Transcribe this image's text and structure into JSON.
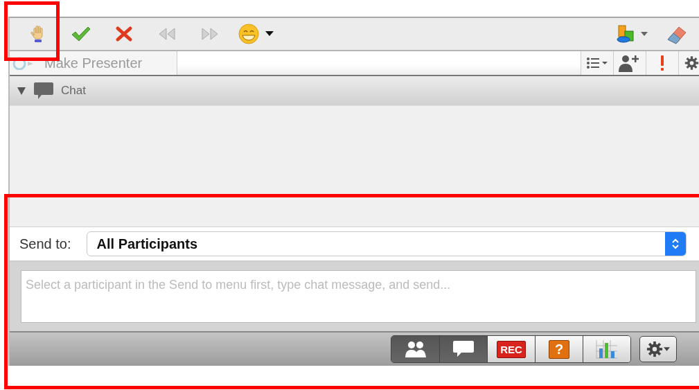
{
  "presenter_button": {
    "label": "Make Presenter",
    "disabled": true
  },
  "chat_panel": {
    "title": "Chat",
    "expanded": true
  },
  "send_to": {
    "label": "Send to:",
    "value": "All Participants"
  },
  "message": {
    "placeholder": "Select a participant in the Send to menu first, type chat message, and send..."
  },
  "panel_tabs": [
    {
      "kind": "participants",
      "selected": true
    },
    {
      "kind": "chat",
      "selected": true
    },
    {
      "kind": "record",
      "label": "REC",
      "selected": false
    },
    {
      "kind": "help",
      "label": "?",
      "selected": false
    },
    {
      "kind": "poll",
      "selected": false
    }
  ]
}
